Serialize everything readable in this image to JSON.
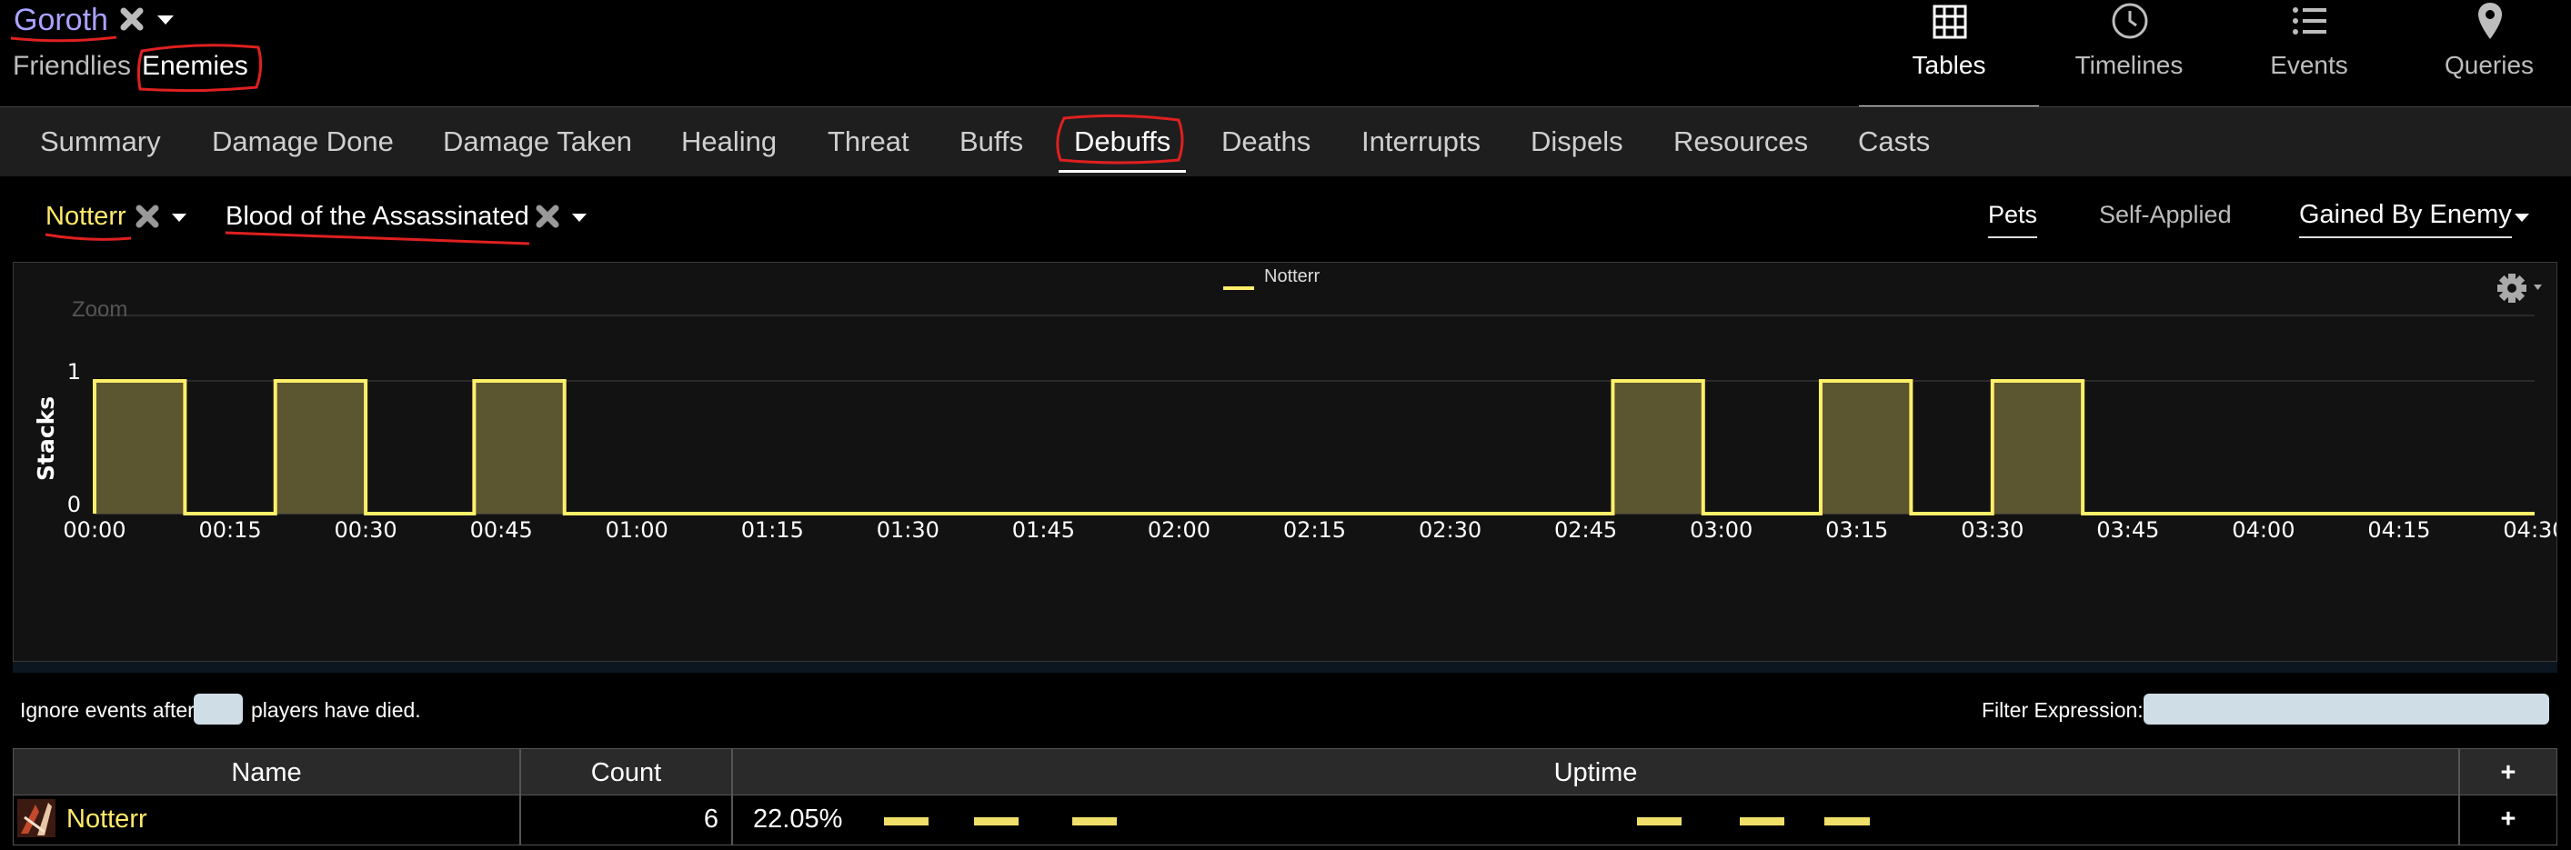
{
  "header": {
    "boss": "Goroth",
    "hostility": {
      "friendlies": "Friendlies",
      "enemies": "Enemies",
      "selected": "enemies"
    }
  },
  "nav": {
    "items": [
      {
        "label": "Tables",
        "icon": "grid-icon",
        "active": true
      },
      {
        "label": "Timelines",
        "icon": "clock-icon"
      },
      {
        "label": "Events",
        "icon": "list-icon"
      },
      {
        "label": "Queries",
        "icon": "map-pin-icon"
      }
    ]
  },
  "tabs": [
    {
      "label": "Summary"
    },
    {
      "label": "Damage Done"
    },
    {
      "label": "Damage Taken"
    },
    {
      "label": "Healing"
    },
    {
      "label": "Threat"
    },
    {
      "label": "Buffs"
    },
    {
      "label": "Debuffs",
      "active": true
    },
    {
      "label": "Deaths"
    },
    {
      "label": "Interrupts"
    },
    {
      "label": "Dispels"
    },
    {
      "label": "Resources"
    },
    {
      "label": "Casts"
    }
  ],
  "filters": {
    "player": "Notterr",
    "ability": "Blood of the Assassinated",
    "pets": "Pets",
    "self_applied": "Self-Applied",
    "gained_by": "Gained By Enemy"
  },
  "chart_data": {
    "type": "area",
    "legend": [
      "Notterr"
    ],
    "legend_position": "top-center",
    "zoom_label": "Zoom",
    "ylabel": "Stacks",
    "yticks": [
      "0",
      "1"
    ],
    "ylim": [
      0,
      1
    ],
    "xlim_seconds": [
      0,
      270
    ],
    "xticks": [
      "00:00",
      "00:15",
      "00:30",
      "00:45",
      "01:00",
      "01:15",
      "01:30",
      "01:45",
      "02:00",
      "02:15",
      "02:30",
      "02:45",
      "03:00",
      "03:15",
      "03:30",
      "03:45",
      "04:00",
      "04:15",
      "04:30"
    ],
    "series": [
      {
        "name": "Notterr",
        "color": "#ffef6a",
        "fill": "#5b5530",
        "intervals": [
          {
            "start": "00:00",
            "end": "00:10",
            "stacks": 1
          },
          {
            "start": "00:20",
            "end": "00:30",
            "stacks": 1
          },
          {
            "start": "00:42",
            "end": "00:52",
            "stacks": 1
          },
          {
            "start": "02:48",
            "end": "02:58",
            "stacks": 1
          },
          {
            "start": "03:11",
            "end": "03:21",
            "stacks": 1
          },
          {
            "start": "03:30",
            "end": "03:40",
            "stacks": 1
          }
        ]
      }
    ],
    "grid": true
  },
  "controls": {
    "ignore_prefix": "Ignore events after",
    "ignore_value": "",
    "ignore_suffix": "players have died.",
    "filter_label": "Filter Expression:",
    "filter_value": ""
  },
  "table": {
    "columns": {
      "name": "Name",
      "count": "Count",
      "uptime": "Uptime",
      "add": "+"
    },
    "rows": [
      {
        "name": "Notterr",
        "count": "6",
        "uptime": "22.05%",
        "add": "+"
      }
    ]
  }
}
